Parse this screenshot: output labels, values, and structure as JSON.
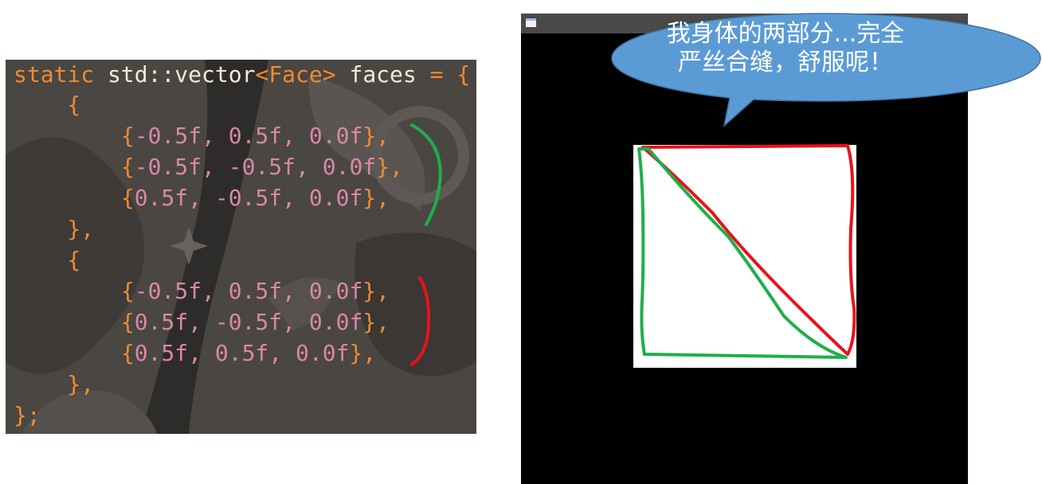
{
  "code": {
    "lines": [
      [
        {
          "t": "static ",
          "c": "kw"
        },
        {
          "t": "std::vector",
          "c": "type"
        },
        {
          "t": "<",
          "c": "kw"
        },
        {
          "t": "Face",
          "c": "kw"
        },
        {
          "t": ">",
          "c": "kw"
        },
        {
          "t": " faces ",
          "c": "plain"
        },
        {
          "t": "= {",
          "c": "kw"
        }
      ],
      [
        {
          "t": "    {",
          "c": "punct"
        }
      ],
      [
        {
          "t": "        {",
          "c": "punct"
        },
        {
          "t": "-0.5f, 0.5f, 0.0f",
          "c": "num"
        },
        {
          "t": "},",
          "c": "punct"
        }
      ],
      [
        {
          "t": "        {",
          "c": "punct"
        },
        {
          "t": "-0.5f, -0.5f, 0.0f",
          "c": "num"
        },
        {
          "t": "},",
          "c": "punct"
        }
      ],
      [
        {
          "t": "        {",
          "c": "punct"
        },
        {
          "t": "0.5f, -0.5f, 0.0f",
          "c": "num"
        },
        {
          "t": "},",
          "c": "punct"
        }
      ],
      [
        {
          "t": "    },",
          "c": "punct"
        }
      ],
      [
        {
          "t": "    {",
          "c": "punct"
        }
      ],
      [
        {
          "t": "        {",
          "c": "punct"
        },
        {
          "t": "-0.5f, 0.5f, 0.0f",
          "c": "num"
        },
        {
          "t": "},",
          "c": "punct"
        }
      ],
      [
        {
          "t": "        {",
          "c": "punct"
        },
        {
          "t": "0.5f, -0.5f, 0.0f",
          "c": "num"
        },
        {
          "t": "},",
          "c": "punct"
        }
      ],
      [
        {
          "t": "        {",
          "c": "punct"
        },
        {
          "t": "0.5f, 0.5f, 0.0f",
          "c": "num"
        },
        {
          "t": "},",
          "c": "punct"
        }
      ],
      [
        {
          "t": "    },",
          "c": "punct"
        }
      ],
      [
        {
          "t": "};",
          "c": "punct"
        }
      ]
    ]
  },
  "annotation_colors": {
    "first_face": "#1fae4a",
    "second_face": "#e8121b"
  },
  "window": {
    "icon": "window-system-icon"
  },
  "bubble": {
    "line1": "我身体的两部分...完全",
    "line2": "严丝合缝，舒服呢！",
    "fill": "#5b9bd5"
  }
}
